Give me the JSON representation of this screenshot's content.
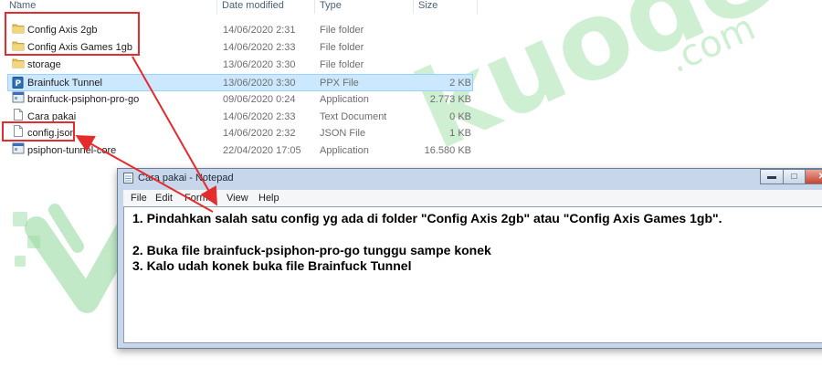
{
  "watermark": {
    "word": "kuoden",
    "suffix": ".com",
    "color": "#7fd18c"
  },
  "explorer": {
    "columns": {
      "name": "Name",
      "date": "Date modified",
      "type": "Type",
      "size": "Size"
    },
    "files": [
      {
        "name": "Config Axis 2gb",
        "date": "14/06/2020 2:31",
        "type": "File folder",
        "size": "",
        "icon": "folder-icon"
      },
      {
        "name": "Config Axis Games 1gb",
        "date": "14/06/2020 2:33",
        "type": "File folder",
        "size": "",
        "icon": "folder-icon"
      },
      {
        "name": "storage",
        "date": "13/06/2020 3:30",
        "type": "File folder",
        "size": "",
        "icon": "folder-icon"
      },
      {
        "name": "Brainfuck Tunnel",
        "date": "13/06/2020 3:30",
        "type": "PPX File",
        "size": "2 KB",
        "icon": "ppx-file-icon",
        "selected": true
      },
      {
        "name": "brainfuck-psiphon-pro-go",
        "date": "09/06/2020 0:24",
        "type": "Application",
        "size": "2.773 KB",
        "icon": "application-icon"
      },
      {
        "name": "Cara pakai",
        "date": "14/06/2020 2:33",
        "type": "Text Document",
        "size": "0 KB",
        "icon": "text-file-icon"
      },
      {
        "name": "config.json",
        "date": "14/06/2020 2:32",
        "type": "JSON File",
        "size": "1 KB",
        "icon": "json-file-icon"
      },
      {
        "name": "psiphon-tunnel-core",
        "date": "22/04/2020 17:05",
        "type": "Application",
        "size": "16.580 KB",
        "icon": "application-icon"
      }
    ]
  },
  "notepad": {
    "title": "Cara pakai - Notepad",
    "menu": [
      "File",
      "Edit",
      "Format",
      "View",
      "Help"
    ],
    "lines": [
      "1. Pindahkan salah satu config yg ada di folder \"Config Axis 2gb\" atau \"Config Axis Games 1gb\".",
      "",
      "2. Buka file brainfuck-psiphon-pro-go tunggu sampe konek",
      "3. Kalo udah konek buka file Brainfuck Tunnel"
    ]
  },
  "colors": {
    "highlight": "#e52b2b",
    "selection": "#cce8ff",
    "window_frame": "#c7d6ea"
  }
}
